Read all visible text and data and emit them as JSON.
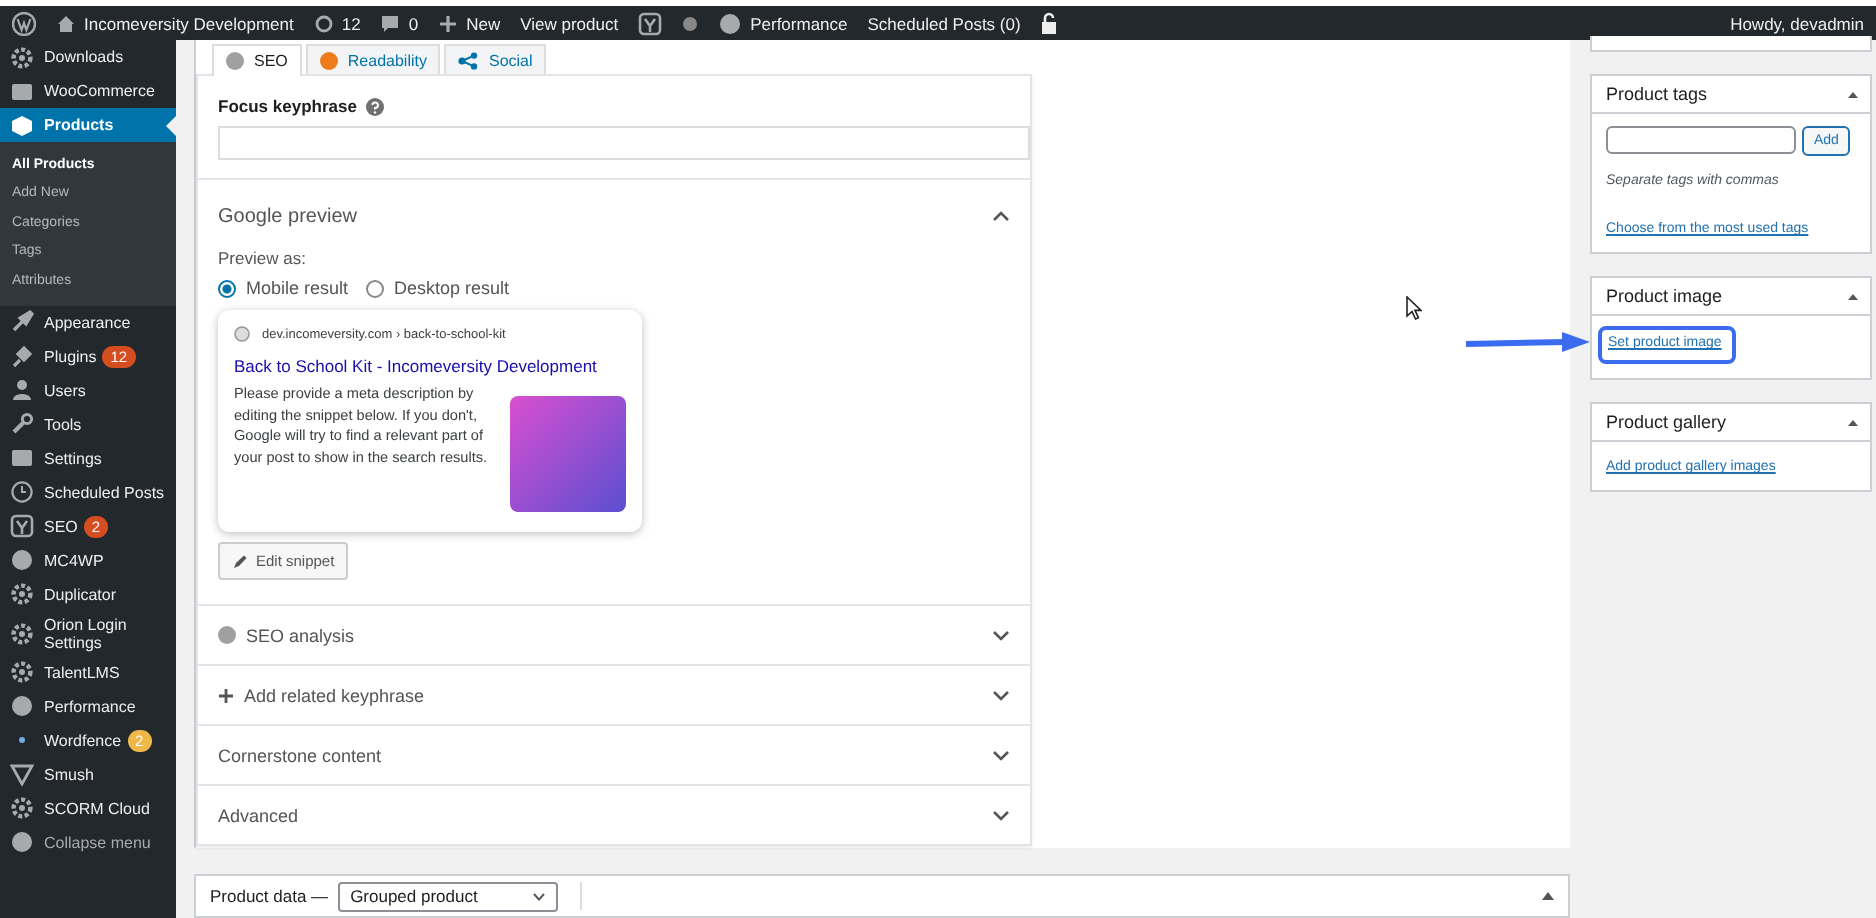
{
  "admin_bar": {
    "site": "Incomeversity Development",
    "updates": "12",
    "comments": "0",
    "new_label": "New",
    "view_label": "View product",
    "performance": "Performance",
    "scheduled": "Scheduled Posts (0)",
    "greeting": "Howdy, devadmin"
  },
  "sidebar": {
    "items": [
      {
        "kind": "menu",
        "label": "Downloads",
        "selected": false
      },
      {
        "kind": "menu",
        "label": "WooCommerce",
        "selected": false
      },
      {
        "kind": "menu",
        "label": "Products",
        "selected": true,
        "children": [
          {
            "label": "All Products",
            "selected": true
          },
          {
            "label": "Add New",
            "selected": false
          },
          {
            "label": "Categories",
            "selected": false
          },
          {
            "label": "Tags",
            "selected": false
          },
          {
            "label": "Attributes",
            "selected": false
          }
        ]
      },
      {
        "kind": "menu",
        "label": "Appearance",
        "selected": false
      },
      {
        "kind": "menu",
        "label": "Plugins",
        "selected": false,
        "badge": "12",
        "color": "#d54e21"
      },
      {
        "kind": "menu",
        "label": "Users",
        "selected": false
      },
      {
        "kind": "menu",
        "label": "Tools",
        "selected": false
      },
      {
        "kind": "menu",
        "label": "Settings",
        "selected": false
      },
      {
        "kind": "menu",
        "label": "Scheduled Posts",
        "selected": false
      },
      {
        "kind": "menu",
        "label": "SEO",
        "selected": false,
        "badge": "2",
        "color": "#d54e21"
      },
      {
        "kind": "menu",
        "label": "MC4WP",
        "selected": false
      },
      {
        "kind": "menu",
        "label": "Duplicator",
        "selected": false
      },
      {
        "kind": "menu",
        "label": "Orion Login Settings",
        "selected": false
      },
      {
        "kind": "menu",
        "label": "TalentLMS",
        "selected": false
      },
      {
        "kind": "menu",
        "label": "Performance",
        "selected": false
      },
      {
        "kind": "menu",
        "label": "Wordfence",
        "selected": false,
        "badge": "2",
        "color": "#f0b849"
      },
      {
        "kind": "menu",
        "label": "Smush",
        "selected": false
      },
      {
        "kind": "menu",
        "label": "SCORM Cloud",
        "selected": false
      },
      {
        "kind": "collapse",
        "label": "Collapse menu",
        "selected": false
      }
    ]
  },
  "yoast": {
    "tabs": [
      {
        "kind": "score",
        "label": "SEO",
        "selected": true,
        "color": "#a0a0a0"
      },
      {
        "kind": "score",
        "label": "Readability",
        "selected": false,
        "color": "#ee7c1b"
      },
      {
        "kind": "social",
        "label": "Social",
        "selected": false
      }
    ],
    "focus_keyphrase": {
      "label": "Focus keyphrase"
    },
    "google_preview": {
      "title": "Google preview",
      "expanded": true,
      "preview_as": "Preview as:",
      "options": [
        {
          "label": "Mobile result",
          "selected": true
        },
        {
          "label": "Desktop result",
          "selected": false
        }
      ],
      "snippet": {
        "url": "dev.incomeversity.com › back-to-school-kit",
        "title": "Back to School Kit - Incomeversity Development",
        "description": "Please provide a meta description by editing the snippet below. If you don't, Google will try to find a relevant part of your post to show in the search results."
      },
      "edit_button": "Edit snippet"
    },
    "sections": [
      {
        "kind": "score",
        "label": "SEO analysis",
        "color": "#a0a0a0"
      },
      {
        "kind": "add",
        "label": "Add related keyphrase"
      },
      {
        "kind": "plain",
        "label": "Cornerstone content"
      },
      {
        "kind": "plain",
        "label": "Advanced"
      }
    ]
  },
  "product_data": {
    "label": "Product data —",
    "type": "Grouped product"
  },
  "side_boxes": [
    {
      "kind": "tags",
      "title": "Product tags",
      "add_button": "Add",
      "hint": "Separate tags with commas",
      "link": "Choose from the most used tags"
    },
    {
      "kind": "image",
      "title": "Product image",
      "link": "Set product image",
      "highlighted": true
    },
    {
      "kind": "gallery",
      "title": "Product gallery",
      "link": "Add product gallery images"
    }
  ]
}
